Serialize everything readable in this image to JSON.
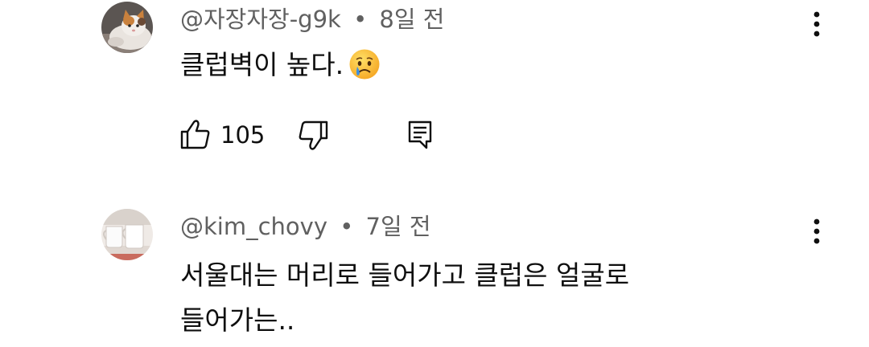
{
  "comments": [
    {
      "author": "@자장자장-g9k",
      "separator": "•",
      "time": "8일 전",
      "text_lines": [
        "클럽벽이 높다."
      ],
      "emoji": "crying-face",
      "likes": "105",
      "avatar": "cat-photo"
    },
    {
      "author": "@kim_chovy",
      "separator": "•",
      "time": "7일 전",
      "text_lines": [
        "서울대는 머리로 들어가고 클럽은 얼굴로",
        "들어가는.."
      ],
      "avatar": "two-cups-photo"
    }
  ],
  "icons": {
    "like": "thumbs-up-icon",
    "dislike": "thumbs-down-icon",
    "reply": "reply-comment-icon",
    "menu": "more-vert-icon"
  },
  "colors": {
    "text": "#0f0f0f",
    "meta": "#606060",
    "background": "#ffffff"
  }
}
